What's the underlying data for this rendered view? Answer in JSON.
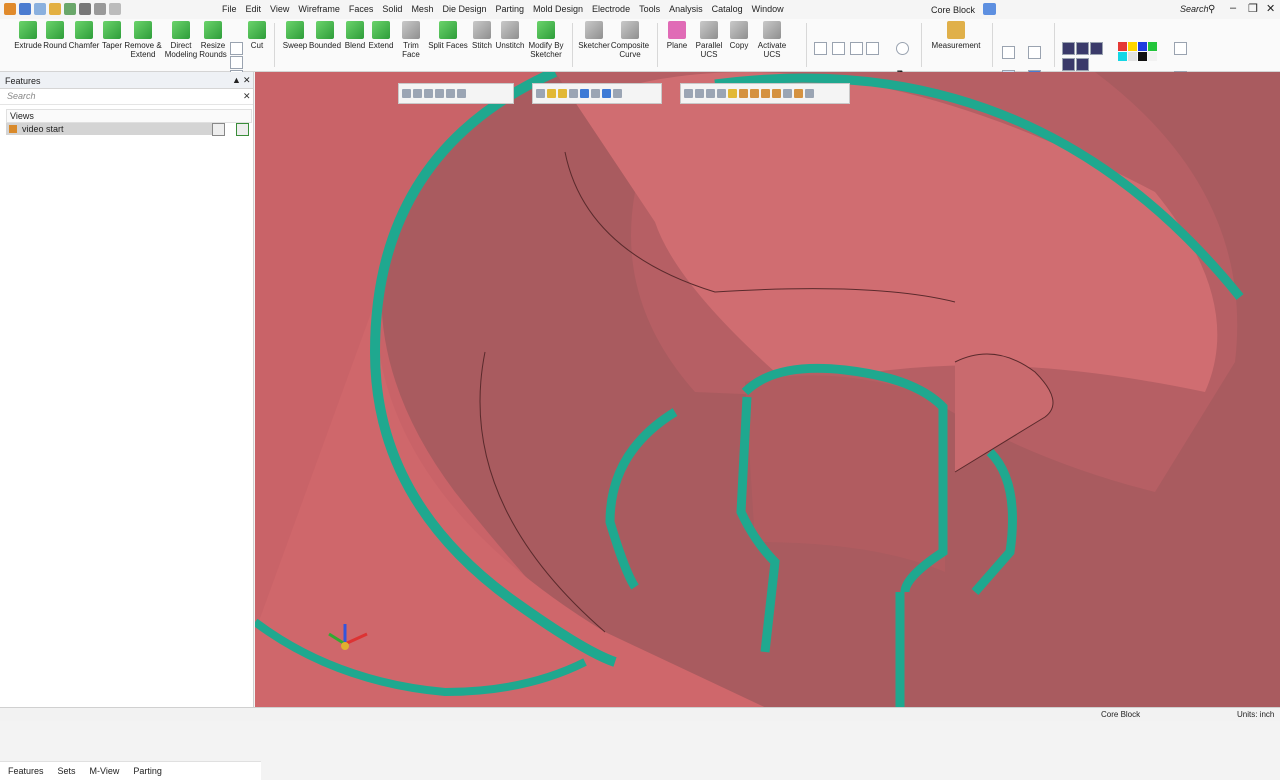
{
  "app": {
    "document_title": "Core Block",
    "menus": [
      "File",
      "Edit",
      "View",
      "Wireframe",
      "Faces",
      "Solid",
      "Mesh",
      "Die Design",
      "Parting",
      "Mold Design",
      "Electrode",
      "Tools",
      "Analysis",
      "Catalog",
      "Window"
    ],
    "search_label": "Search"
  },
  "ribbon": {
    "buttons": [
      {
        "label": "Extrude"
      },
      {
        "label": "Round"
      },
      {
        "label": "Chamfer"
      },
      {
        "label": "Taper"
      },
      {
        "label": "Remove &\nExtend"
      },
      {
        "label": "Direct\nModeling"
      },
      {
        "label": "Resize\nRounds"
      },
      {
        "label": "Cut"
      },
      {
        "label": "Sweep"
      },
      {
        "label": "Bounded"
      },
      {
        "label": "Blend"
      },
      {
        "label": "Extend"
      },
      {
        "label": "Trim Face"
      },
      {
        "label": "Split Faces"
      },
      {
        "label": "Stitch"
      },
      {
        "label": "Unstitch"
      },
      {
        "label": "Modify By\nSketcher"
      },
      {
        "label": "Sketcher"
      },
      {
        "label": "Composite\nCurve"
      },
      {
        "label": "Plane"
      },
      {
        "label": "Parallel UCS"
      },
      {
        "label": "Copy"
      },
      {
        "label": "Activate UCS"
      },
      {
        "label": "Measurement"
      }
    ]
  },
  "left_panel": {
    "title": "Features",
    "search_placeholder": "Search",
    "views_header": "Views",
    "view_item": "video start",
    "bottom_tabs": [
      "Features",
      "Sets",
      "M-View",
      "Parting"
    ]
  },
  "status": {
    "document": "Core Block",
    "units": "Units: inch"
  },
  "colors": {
    "part_face": "#d46a6e",
    "part_shadow": "#a85a5e",
    "highlight_edge": "#1fa88f"
  }
}
